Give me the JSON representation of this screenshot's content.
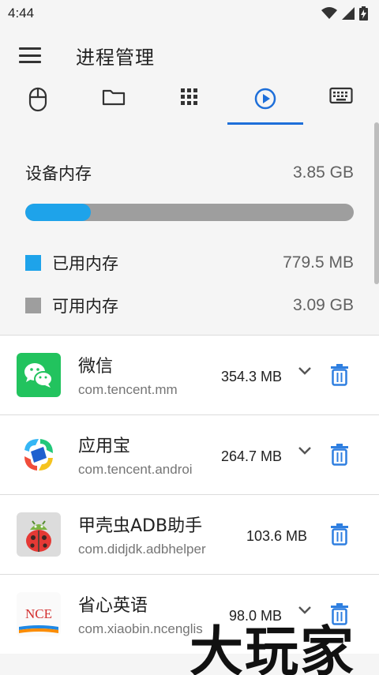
{
  "status_bar": {
    "time": "4:44"
  },
  "app_bar": {
    "title": "进程管理"
  },
  "tabs": [
    {
      "icon": "mouse-icon"
    },
    {
      "icon": "folder-icon"
    },
    {
      "icon": "apps-grid-icon"
    },
    {
      "icon": "play-circle-icon",
      "active": true
    },
    {
      "icon": "keyboard-icon"
    }
  ],
  "memory": {
    "title": "设备内存",
    "total": "3.85 GB",
    "used_fraction": 0.2,
    "used_label": "已用内存",
    "used_value": "779.5 MB",
    "free_label": "可用内存",
    "free_value": "3.09 GB",
    "used_color": "#1ea3ea",
    "free_color": "#9e9e9e"
  },
  "apps": [
    {
      "name": "微信",
      "package": "com.tencent.mm",
      "size": "354.3 MB",
      "icon": "wechat-icon"
    },
    {
      "name": "应用宝",
      "package": "com.tencent.androi",
      "size": "264.7 MB",
      "icon": "app-store-icon"
    },
    {
      "name": "甲壳虫ADB助手",
      "package": "com.didjdk.adbhelper",
      "size": "103.6 MB",
      "icon": "ladybug-android-icon"
    },
    {
      "name": "省心英语",
      "package": "com.xiaobin.ncenglis",
      "size": "98.0 MB",
      "icon": "nce-icon"
    }
  ],
  "nce_icon_text": "NCE",
  "watermark": "大玩家"
}
